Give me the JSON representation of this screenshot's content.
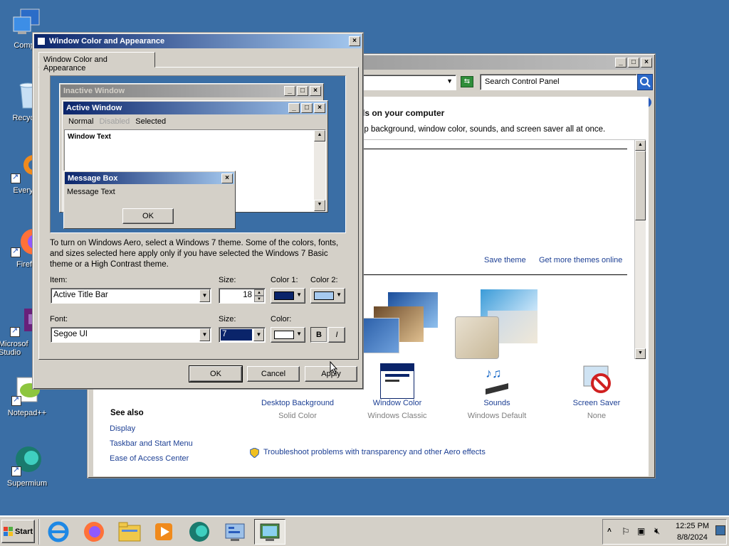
{
  "desktop": {
    "icons": [
      {
        "label": "Comp",
        "icon": "computer-icon"
      },
      {
        "label": "Recycl",
        "icon": "recycle-bin-icon"
      },
      {
        "label": "Everyt",
        "icon": "everything-icon"
      },
      {
        "label": "Firef",
        "icon": "firefox-icon"
      },
      {
        "label": "Microsof Studio",
        "icon": "visual-studio-icon"
      },
      {
        "label": "Notepad++",
        "icon": "notepadpp-icon"
      },
      {
        "label": "Supermium",
        "icon": "supermium-icon"
      }
    ]
  },
  "control_panel": {
    "search_placeholder": "Search Control Panel",
    "heading": "ds on your computer",
    "description": "op background, window color, sounds, and screen saver all at once.",
    "save_theme": "Save theme",
    "get_more_themes": "Get more themes online",
    "see_also_title": "See also",
    "see_also": [
      "Display",
      "Taskbar and Start Menu",
      "Ease of Access Center"
    ],
    "items": [
      {
        "label": "Desktop Background",
        "sub": "Solid Color"
      },
      {
        "label": "Window Color",
        "sub": "Windows Classic"
      },
      {
        "label": "Sounds",
        "sub": "Windows Default"
      },
      {
        "label": "Screen Saver",
        "sub": "None"
      }
    ],
    "troubleshoot": "Troubleshoot problems with transparency and other Aero effects"
  },
  "dialog": {
    "title": "Window Color and Appearance",
    "tab": "Window Color and Appearance",
    "preview": {
      "inactive_title": "Inactive Window",
      "active_title": "Active Window",
      "menu": [
        "Normal",
        "Disabled",
        "Selected"
      ],
      "window_text": "Window Text",
      "msgbox_title": "Message Box",
      "msgbox_text": "Message Text",
      "msgbox_ok": "OK"
    },
    "info": "To turn on Windows Aero, select a Windows 7 theme.  Some of the colors, fonts, and sizes selected here apply only if you have selected the Windows 7 Basic theme or a High Contrast theme.",
    "item_label": "Item:",
    "item_value": "Active Title Bar",
    "size_label": "Size:",
    "size_value": "18",
    "color1_label": "Color 1:",
    "color2_label": "Color 2:",
    "font_label": "Font:",
    "font_value": "Segoe UI",
    "font_size_label": "Size:",
    "font_size_value": "7",
    "color_label": "Color:",
    "bold": "B",
    "italic": "I",
    "ok": "OK",
    "cancel": "Cancel",
    "apply": "Apply",
    "colors": {
      "color1": "#0a246a",
      "color2": "#a6caf0",
      "font_color": "#ffffff"
    }
  },
  "taskbar": {
    "start": "Start",
    "time": "12:25 PM",
    "date": "8/8/2024"
  }
}
